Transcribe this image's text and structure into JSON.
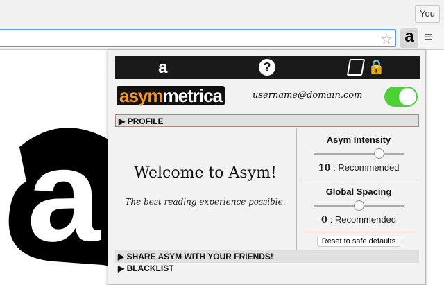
{
  "browser": {
    "profile_label": "You",
    "star_icon": "☆",
    "extension_icon": "a",
    "menu_icon": "≡"
  },
  "popup": {
    "nav": {
      "home_icon": "a",
      "help_icon": "?",
      "privacy_icon": "🔒"
    },
    "brand": {
      "part1": "asym",
      "part2": "metrica"
    },
    "email": "username@domain.com",
    "enabled": true,
    "sections": {
      "profile": "▶  PROFILE",
      "share": "▶  SHARE ASYM WITH YOUR FRIENDS!",
      "blacklist": "▶  BLACKLIST"
    },
    "welcome": {
      "title": "Welcome to Asym!",
      "subtitle": "The best reading experience possible."
    },
    "controls": [
      {
        "label": "Asym Intensity",
        "value": "10",
        "desc": ": Recommended",
        "fraction": 0.72
      },
      {
        "label": "Global Spacing",
        "value": "0",
        "desc": ": Recommended",
        "fraction": 0.5
      }
    ],
    "reset_label": "Reset to safe defaults"
  }
}
